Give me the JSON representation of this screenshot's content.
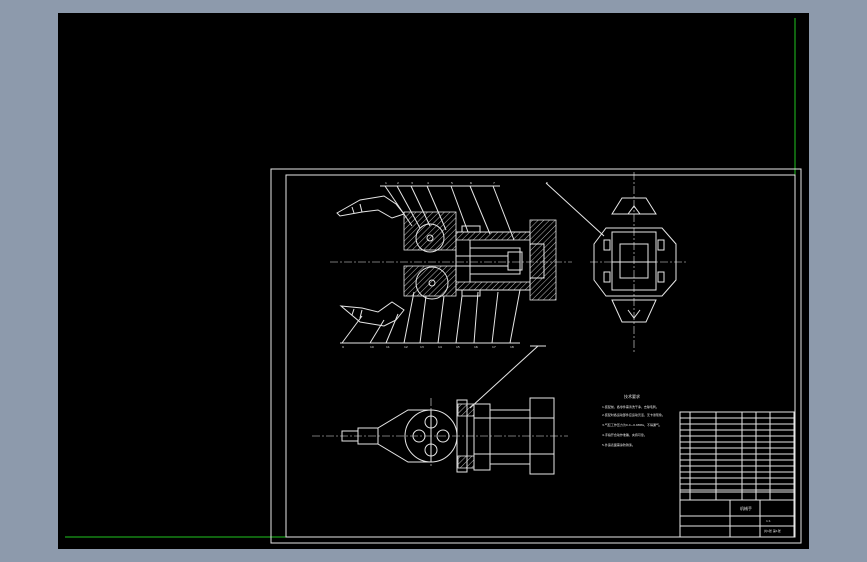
{
  "colors": {
    "app_background": "#8d9aac",
    "canvas_background": "#000000",
    "linework": "#e6e6e6",
    "guide_line": "#1fc41f"
  },
  "drawing": {
    "tech_title": "技术要求",
    "tech_notes": [
      "1.装配前，各零件需清洗干净，去除毛刺。",
      "2.装配时各运动部件应运动灵活，无卡滞现象。",
      "3.气缸工作压力为0.4~0.6MPa，不得漏气。",
      "4.手指开合动作准确，夹持可靠。",
      "5.外露表面需涂防锈漆。"
    ],
    "title_block": {
      "name": "机械手",
      "scale": "1:1",
      "sheet": "共1张 第1张"
    },
    "part_labels_top": [
      "1",
      "2",
      "3",
      "4",
      "5",
      "6",
      "7",
      "8"
    ],
    "part_labels_bottom": [
      "9",
      "10",
      "11",
      "12",
      "13",
      "14",
      "15",
      "16",
      "17",
      "18"
    ]
  }
}
